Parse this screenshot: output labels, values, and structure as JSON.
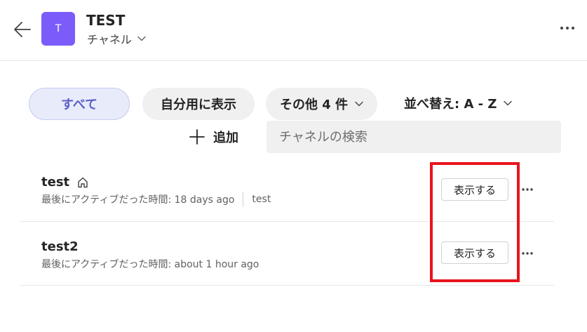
{
  "header": {
    "avatar_letter": "T",
    "team_name": "TEST",
    "channel_picker_label": "チャネル"
  },
  "filters": {
    "all_label": "すべて",
    "mine_label": "自分用に表示",
    "more_label": "その他 4 件",
    "sort_label": "並べ替え: A - Z"
  },
  "add_label": "追加",
  "search": {
    "placeholder": "チャネルの検索",
    "value": ""
  },
  "channels": [
    {
      "name": "test",
      "meta_label": "最後にアクティブだった時間: 18 days ago",
      "extra": "test",
      "is_home": true,
      "view_label": "表示する"
    },
    {
      "name": "test2",
      "meta_label": "最後にアクティブだった時間: about 1 hour ago",
      "view_label": "表示する"
    }
  ],
  "colors": {
    "accent": "#5b5fc7",
    "avatar": "#7b5cfa",
    "highlight": "#e8141e"
  },
  "icons": {
    "back": "back-arrow-icon",
    "more": "more-horizontal-icon",
    "chevron": "chevron-down-icon",
    "add": "plus-icon",
    "home": "home-icon"
  }
}
